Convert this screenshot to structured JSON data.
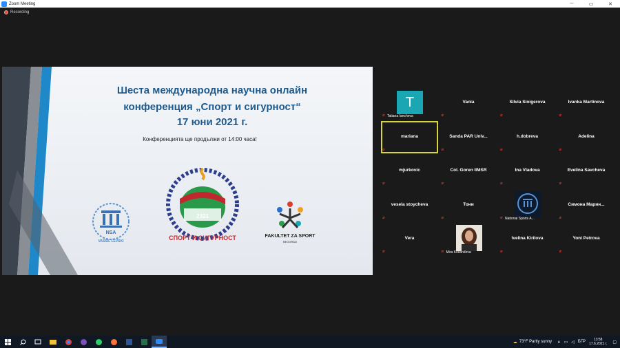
{
  "window": {
    "title": "Zoom Meeting",
    "minimize": "─",
    "maximize": "▭",
    "close": "✕"
  },
  "recording": {
    "label": "Recording"
  },
  "slide": {
    "title_line1": "Шеста международна научна онлайн",
    "title_line2": "конференция „Спорт и сигурност“",
    "title_line3": "17 юни 2021 г.",
    "subtitle": "Конференцията ще продължи от 14:00 часа!",
    "nsa_logo_text": "NSA",
    "nsa_logo_caption": "VASSIL LEVSKI",
    "conf_logo_arc": "ШЕСТА МЕЖДУНАРОДНА НАУЧНА КОНФЕРЕНЦИЯ",
    "conf_logo_year": "2021",
    "conf_logo_bottom": "СПОРТ И СИГУРНОСТ",
    "fzs_caption": "FAKULTET ZA SPORT",
    "fzs_sub": "BEOGRAD"
  },
  "participants": [
    {
      "name": "",
      "footer": "Tatiana Iancheva",
      "avatar": "T"
    },
    {
      "name": "Vania",
      "footer": ""
    },
    {
      "name": "Silvia Sinigerova",
      "footer": ""
    },
    {
      "name": "Ivanka Martinova",
      "footer": ""
    },
    {
      "name": "mariana",
      "footer": ""
    },
    {
      "name": "Sanda PAR Univ...",
      "footer": ""
    },
    {
      "name": "h.dobreva",
      "footer": ""
    },
    {
      "name": "Adelina",
      "footer": ""
    },
    {
      "name": "mjurkovic",
      "footer": ""
    },
    {
      "name": "Col. Goren IIMSR",
      "footer": ""
    },
    {
      "name": "Ina Vladova",
      "footer": ""
    },
    {
      "name": "Evelina Savcheva",
      "footer": ""
    },
    {
      "name": "vesela stoycheva",
      "footer": ""
    },
    {
      "name": "Тони",
      "footer": ""
    },
    {
      "name": "",
      "footer": "National Sports A..."
    },
    {
      "name": "Симона  Марин...",
      "footer": ""
    },
    {
      "name": "Vera",
      "footer": ""
    },
    {
      "name": "",
      "footer": "Mira Kokandova"
    },
    {
      "name": "Ivelina Kirilova",
      "footer": ""
    },
    {
      "name": "Yoni Petrova",
      "footer": ""
    }
  ],
  "taskbar": {
    "weather": "73°F  Partly sunny",
    "lang": "БГР",
    "time": "13:58",
    "date": "17.6.2021 г."
  },
  "colors": {
    "accent": "#2d8cff",
    "active_speaker": "#d6d63a",
    "slide_title": "#1f5a8e"
  }
}
